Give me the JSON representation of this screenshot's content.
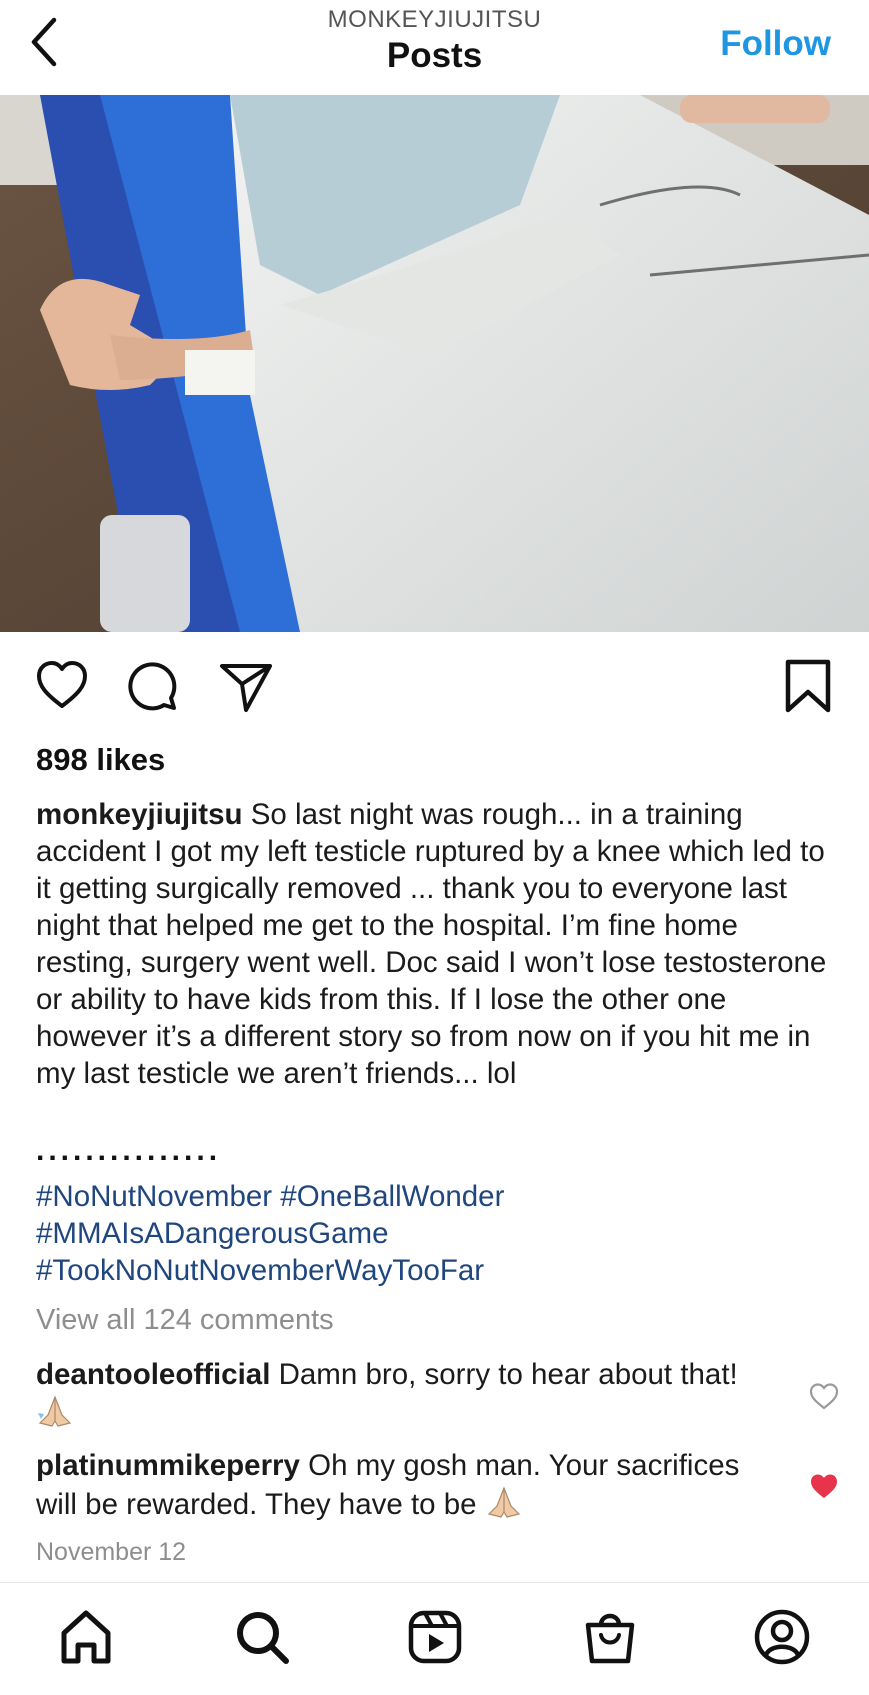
{
  "header": {
    "account": "MONKEYJIUJITSU",
    "title": "Posts",
    "follow_label": "Follow"
  },
  "post": {
    "likes": "898 likes",
    "author": "monkeyjiujitsu",
    "caption": "So last night was rough... in a training accident I got my left testicle ruptured by a knee which led to it getting surgically removed ... thank you to everyone last night that helped me get to the hospital. I’m fine home resting, surgery went well. Doc said I won’t lose testosterone or ability to have kids from this. If I lose the other one however it’s a different story so from now on if you hit me in my last testicle we aren’t friends... lol",
    "dots": "...............",
    "hashtags": [
      "#NoNutNovember #OneBallWonder",
      "#MMAIsADangerousGame",
      "#TookNoNutNovemberWayTooFar"
    ],
    "view_all": "View all 124 comments",
    "date": "November 12"
  },
  "comments": [
    {
      "user": "deantooleofficial",
      "text": "Damn bro, sorry to hear about that!",
      "emoji": "folded-hands",
      "liked": false
    },
    {
      "user": "platinummikeperry",
      "text": "Oh my gosh man. Your sacrifices will be rewarded. They have to be",
      "emoji": "folded-hands",
      "liked": true
    }
  ],
  "icons": {
    "actions": [
      "heart-icon",
      "comment-icon",
      "share-icon",
      "bookmark-icon"
    ],
    "tabs": [
      "home-icon",
      "search-icon",
      "reels-icon",
      "shop-icon",
      "profile-icon"
    ]
  },
  "colors": {
    "follow_blue": "#1f96e2",
    "hashtag_blue": "#20467e",
    "liked_red": "#e8344a",
    "muted_gray": "#8e8e8e"
  }
}
